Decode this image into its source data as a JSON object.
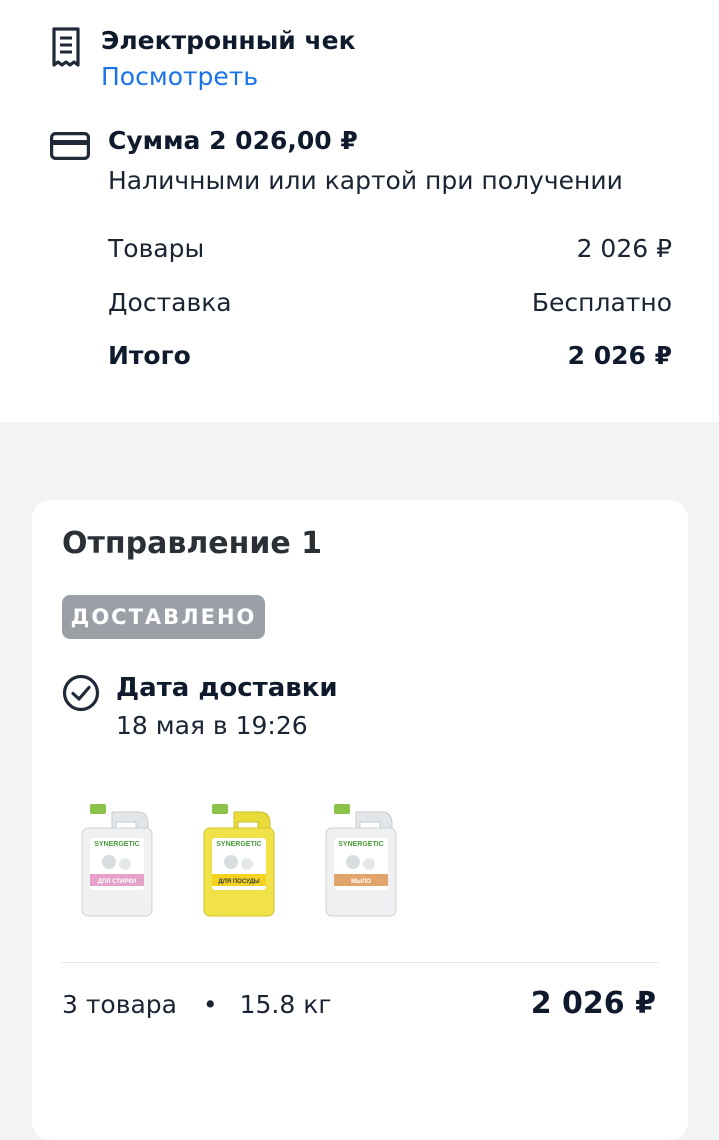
{
  "receipt": {
    "title": "Электронный чек",
    "link": "Посмотреть",
    "icon": "receipt-icon"
  },
  "payment": {
    "title": "Сумма 2 026,00 ₽",
    "subtitle": "Наличными или картой при получении",
    "icon": "credit-card-icon",
    "rows": [
      {
        "label": "Товары",
        "value": "2 026 ₽"
      },
      {
        "label": "Доставка",
        "value": "Бесплатно"
      },
      {
        "label": "Итого",
        "value": "2 026 ₽"
      }
    ]
  },
  "shipment": {
    "title": "Отправление 1",
    "status": "ДОСТАВЛЕНО",
    "status_color": "#9aa0a6",
    "delivery_label": "Дата доставки",
    "delivery_date": "18 мая в 19:26",
    "products": [
      {
        "name": "product-laundry",
        "brand": "SYNERGETIC",
        "label": "ДЛЯ СТИРКИ",
        "cap": "#8bc34a",
        "body": "#eef0f1",
        "band": "#e6a1c8"
      },
      {
        "name": "product-dishes",
        "brand": "SYNERGETIC",
        "label": "ДЛЯ ПОСУДЫ",
        "cap": "#8bc34a",
        "body": "#f1e24a",
        "band": "#f5d21f"
      },
      {
        "name": "product-soap",
        "brand": "SYNERGETIC",
        "label": "МЫЛО",
        "cap": "#8bc34a",
        "body": "#eef0f1",
        "band": "#e1a46b"
      }
    ],
    "count_text": "3 товара",
    "weight_text": "15.8 кг",
    "separator": "•",
    "total": "2 026 ₽"
  },
  "colors": {
    "link": "#1a73e8",
    "text": "#0f1b2d",
    "page_bg": "#f2f3f5"
  }
}
